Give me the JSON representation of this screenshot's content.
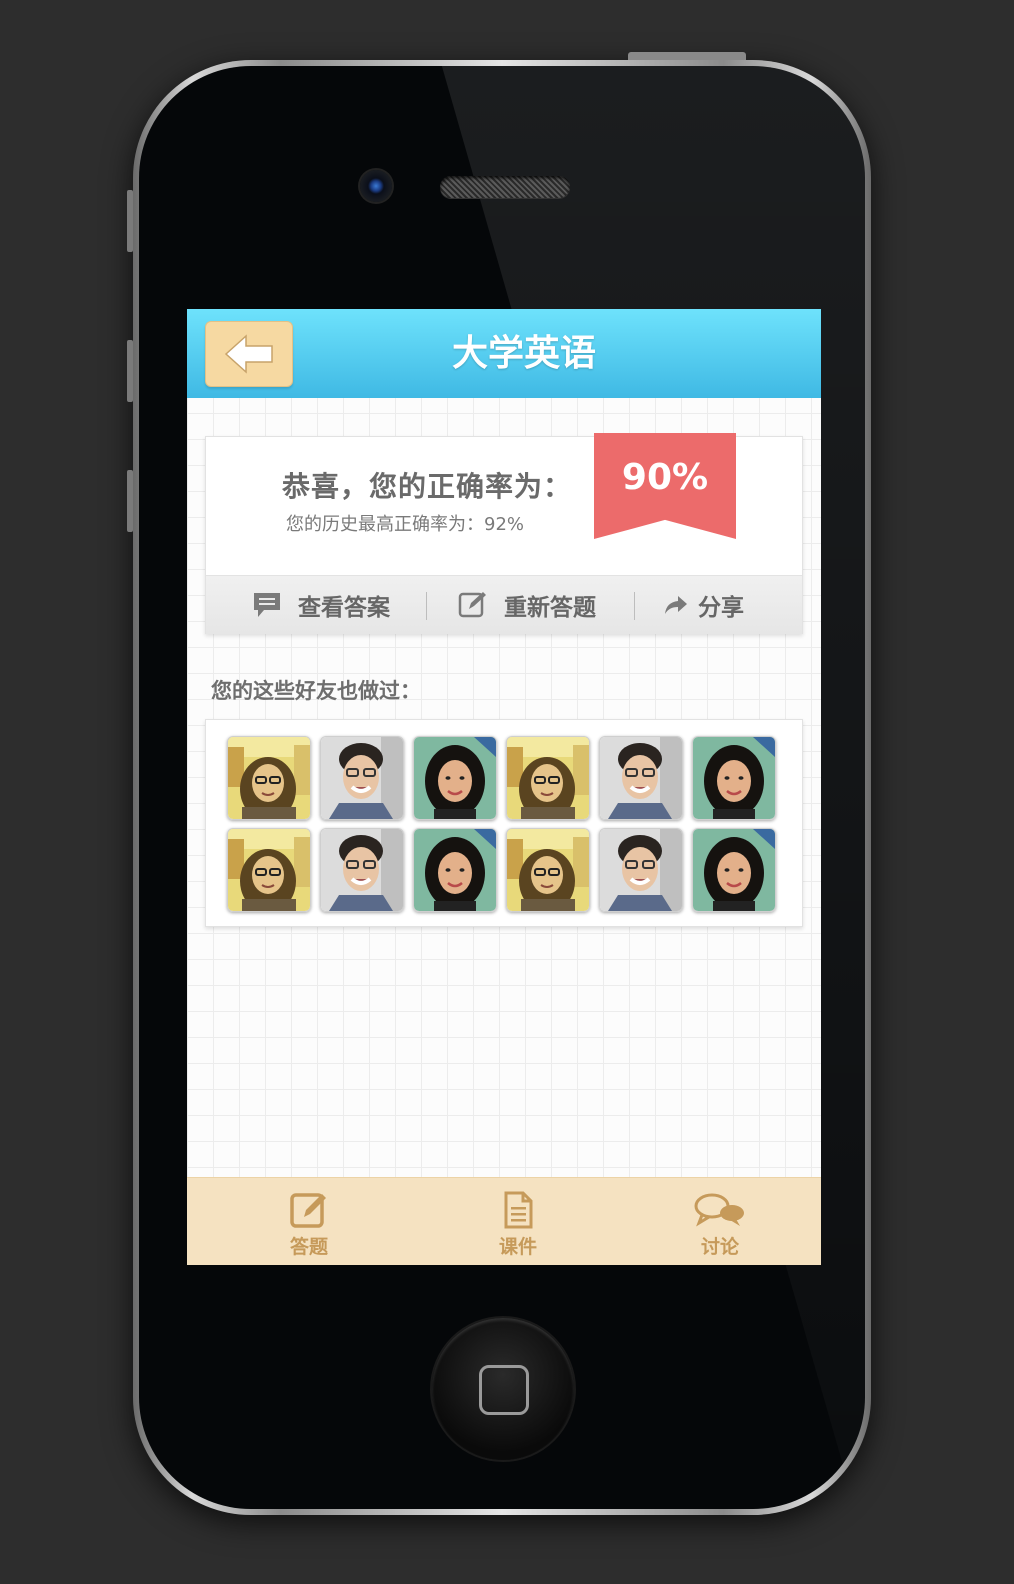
{
  "header": {
    "title": "大学英语",
    "back_icon": "back-arrow-icon"
  },
  "result": {
    "congrats_text": "恭喜，您的正确率为：",
    "history_text": "您的历史最高正确率为：92%",
    "score": "90%"
  },
  "actions": [
    {
      "label": "查看答案",
      "icon": "comment-icon"
    },
    {
      "label": "重新答题",
      "icon": "edit-icon"
    },
    {
      "label": "分享",
      "icon": "share-icon"
    }
  ],
  "friends": {
    "label": "您的这些好友也做过：",
    "avatars": [
      "girl-glasses",
      "man-glasses",
      "woman",
      "girl-glasses",
      "man-glasses",
      "woman",
      "girl-glasses",
      "man-glasses",
      "woman",
      "girl-glasses",
      "man-glasses",
      "woman"
    ]
  },
  "tabs": [
    {
      "label": "答题",
      "icon": "edit-icon"
    },
    {
      "label": "课件",
      "icon": "document-icon"
    },
    {
      "label": "讨论",
      "icon": "chat-icon"
    }
  ],
  "colors": {
    "navbar_top": "#6ee2fc",
    "navbar_bottom": "#3fb9e4",
    "ribbon": "#ec6b6b",
    "tabbar": "#f5e2c1",
    "tab_text": "#c69a5a",
    "back_button": "#f6d9a2"
  }
}
